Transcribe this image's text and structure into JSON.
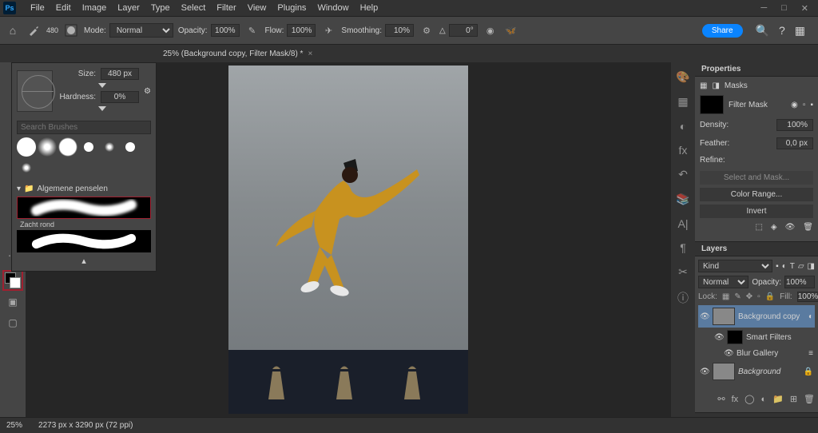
{
  "app": {
    "name": "Ps"
  },
  "menu": [
    "File",
    "Edit",
    "Image",
    "Layer",
    "Type",
    "Select",
    "Filter",
    "View",
    "Plugins",
    "Window",
    "Help"
  ],
  "options": {
    "brush_size": "480",
    "mode_label": "Mode:",
    "mode_value": "Normal",
    "opacity_label": "Opacity:",
    "opacity_value": "100%",
    "flow_label": "Flow:",
    "flow_value": "100%",
    "smoothing_label": "Smoothing:",
    "smoothing_value": "10%",
    "angle_label": "△",
    "angle_value": "0°",
    "share": "Share"
  },
  "doc_tab": "25% (Background copy, Filter Mask/8) *",
  "brush_panel": {
    "size_label": "Size:",
    "size_value": "480 px",
    "hardness_label": "Hardness:",
    "hardness_value": "0%",
    "search_placeholder": "Search Brushes",
    "folder": "Algemene penselen",
    "stroke_label": "Zacht rond"
  },
  "properties": {
    "title": "Properties",
    "section": "Masks",
    "mask_label": "Filter Mask",
    "density_label": "Density:",
    "density_value": "100%",
    "feather_label": "Feather:",
    "feather_value": "0,0 px",
    "refine_label": "Refine:",
    "select_mask": "Select and Mask...",
    "color_range": "Color Range...",
    "invert": "Invert"
  },
  "layers": {
    "title": "Layers",
    "kind": "Kind",
    "blend": "Normal",
    "opacity_label": "Opacity:",
    "opacity_value": "100%",
    "lock_label": "Lock:",
    "fill_label": "Fill:",
    "fill_value": "100%",
    "items": [
      {
        "name": "Background copy",
        "active": true
      },
      {
        "name": "Smart Filters"
      },
      {
        "name": "Blur Gallery"
      },
      {
        "name": "Background",
        "italic": true
      }
    ]
  },
  "status": {
    "zoom": "25%",
    "dims": "2273 px x 3290 px (72 ppi)"
  }
}
